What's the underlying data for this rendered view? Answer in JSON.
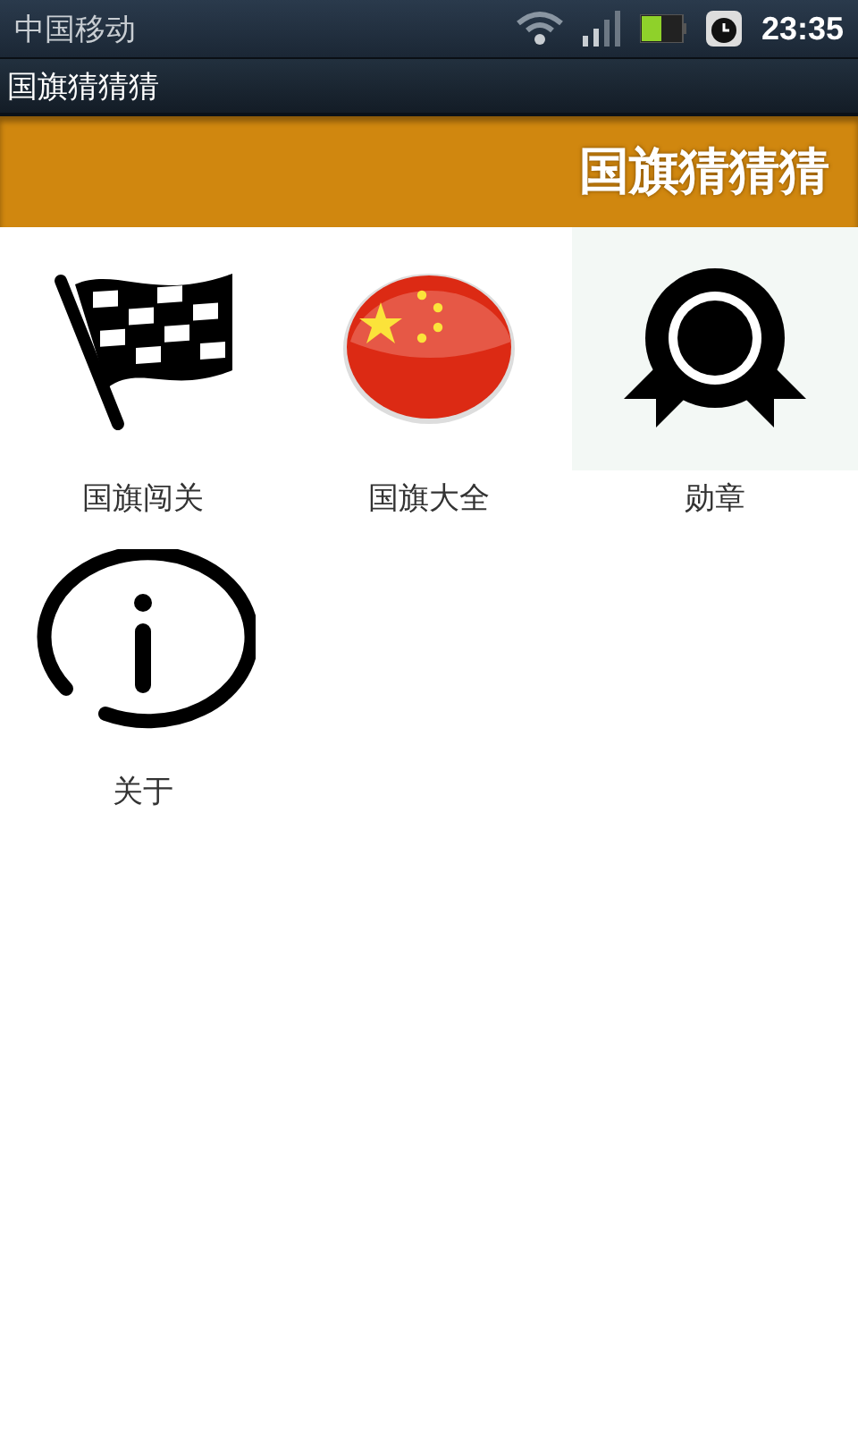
{
  "status_bar": {
    "carrier": "中国移动",
    "time": "23:35"
  },
  "app_bar": {
    "title": "国旗猜猜猜"
  },
  "banner": {
    "title": "国旗猜猜猜"
  },
  "menu": [
    {
      "label": "国旗闯关",
      "kind": "flag",
      "selected": false
    },
    {
      "label": "国旗大全",
      "kind": "china",
      "selected": false
    },
    {
      "label": "勋章",
      "kind": "medal",
      "selected": true
    },
    {
      "label": "关于",
      "kind": "info",
      "selected": false
    }
  ]
}
